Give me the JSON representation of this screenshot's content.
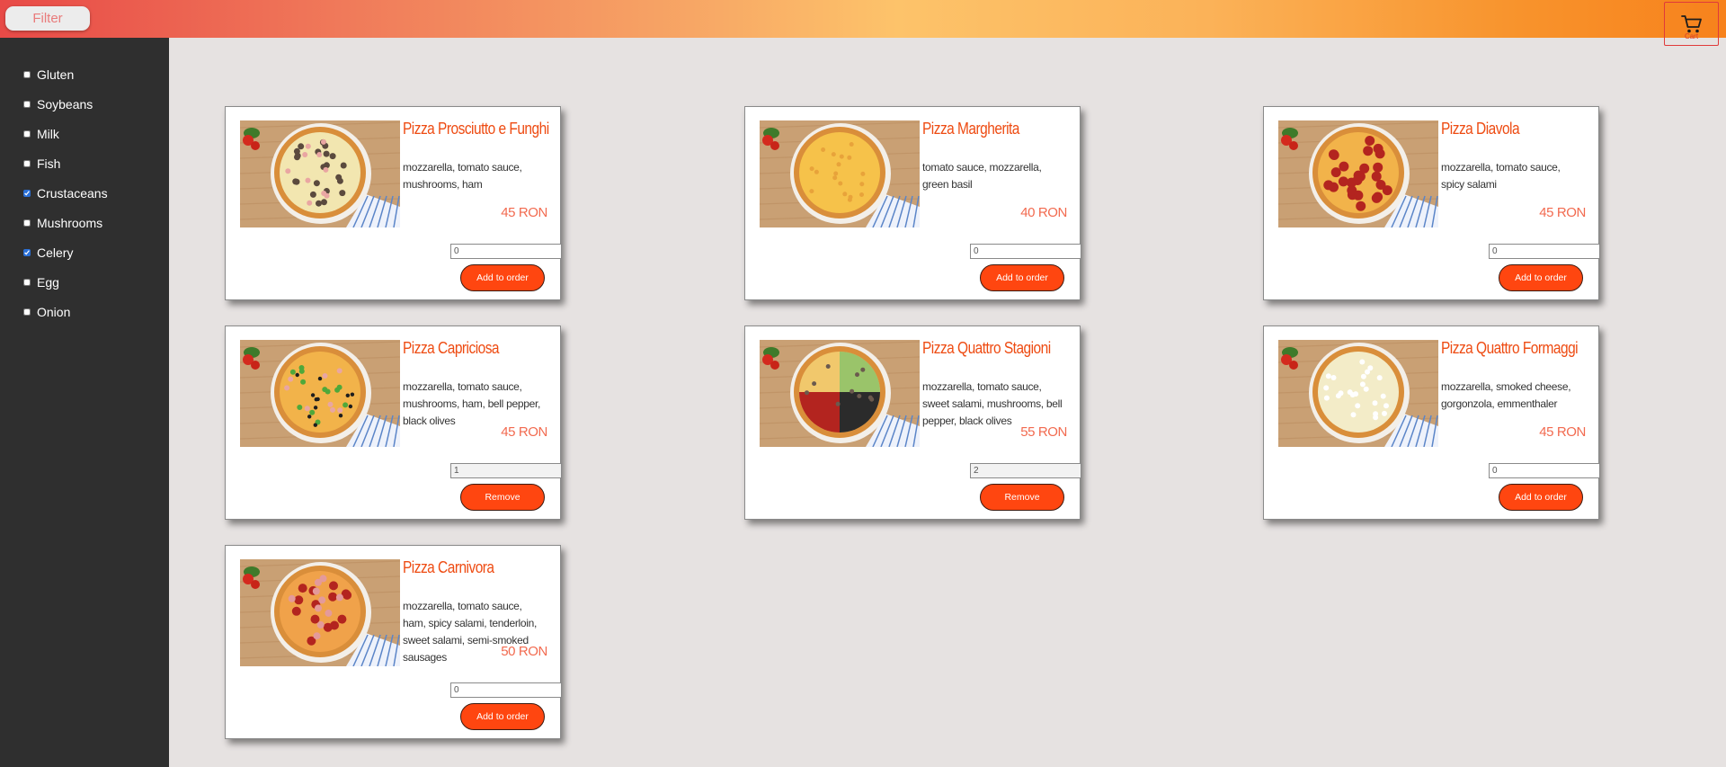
{
  "header": {
    "filter_label": "Filter",
    "cart_label": "Cart"
  },
  "allergens": [
    {
      "label": "Gluten",
      "checked": false
    },
    {
      "label": "Soybeans",
      "checked": false
    },
    {
      "label": "Milk",
      "checked": false
    },
    {
      "label": "Fish",
      "checked": false
    },
    {
      "label": "Crustaceans",
      "checked": true
    },
    {
      "label": "Mushrooms",
      "checked": false
    },
    {
      "label": "Celery",
      "checked": true
    },
    {
      "label": "Egg",
      "checked": false
    },
    {
      "label": "Onion",
      "checked": false
    }
  ],
  "pizzas": [
    {
      "name": "Pizza Prosciutto e Funghi",
      "description": "mozzarella, tomato sauce, mushrooms, ham",
      "price": "45 RON",
      "quantity": "0",
      "button_label": "Add to order",
      "topping": "mushroom"
    },
    {
      "name": "Pizza Margherita",
      "description": "tomato sauce, mozzarella, green basil",
      "price": "40 RON",
      "quantity": "0",
      "button_label": "Add to order",
      "topping": "cheese"
    },
    {
      "name": "Pizza Diavola",
      "description": "mozzarella, tomato sauce, spicy salami",
      "price": "45 RON",
      "quantity": "0",
      "button_label": "Add to order",
      "topping": "salami"
    },
    {
      "name": "Pizza Capriciosa",
      "description": "mozzarella, tomato sauce, mushrooms, ham, bell pepper, black olives",
      "price": "45 RON",
      "quantity": "1",
      "button_label": "Remove",
      "topping": "mixed"
    },
    {
      "name": "Pizza Quattro Stagioni",
      "description": "mozzarella, tomato sauce, sweet salami, mushrooms, bell pepper, black olives",
      "price": "55 RON",
      "quantity": "2",
      "button_label": "Remove",
      "topping": "quattro"
    },
    {
      "name": "Pizza Quattro Formaggi",
      "description": "mozzarella, smoked cheese, gorgonzola, emmenthaler",
      "price": "45 RON",
      "quantity": "0",
      "button_label": "Add to order",
      "topping": "white"
    },
    {
      "name": "Pizza Carnivora",
      "description": "mozzarella, tomato sauce, ham, spicy salami, tenderloin, sweet salami, semi-smoked sausages",
      "price": "50 RON",
      "quantity": "0",
      "button_label": "Add to order",
      "topping": "carnivora"
    }
  ],
  "colors": {
    "accent": "#ff4610",
    "title": "#ee4b12",
    "price": "#f26a4f",
    "sidebar": "#2f2f2f",
    "background": "#e6e2e1"
  }
}
